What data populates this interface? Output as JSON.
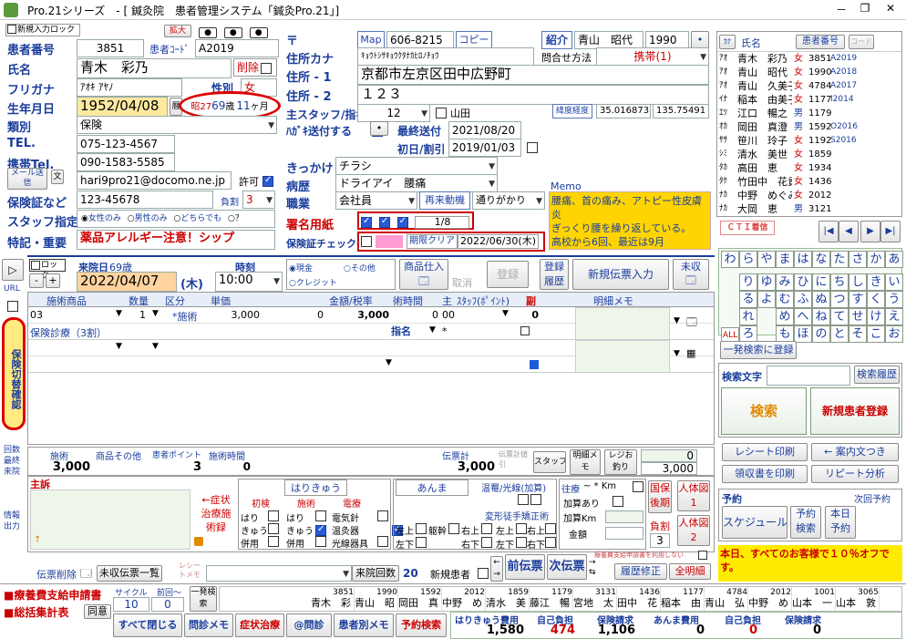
{
  "window": {
    "title": "Pro.21シリーズ　- [ 鍼灸院　患者管理システム「鍼灸Pro.21」]",
    "minimize": "－",
    "restore": "❐",
    "close": "✕"
  },
  "toolbar": {
    "new_patient": "新規入力ロック",
    "expand": "拡大"
  },
  "patient": {
    "id_label": "患者番号",
    "id": "3851",
    "code_label": "患者ｺｰﾄﾞ",
    "code": "A2019",
    "name_label": "氏名",
    "name": "青木　彩乃",
    "delete_label": "削除",
    "furigana_label": "フリガナ",
    "furigana": "ｱｵｷ ｱﾔﾉ",
    "sex_label": "性別",
    "sex": "女",
    "birth_label": "生年月日",
    "birth": "1952/04/08",
    "calendar_btn": "暦",
    "age_era": "昭27",
    "age_years": "69",
    "age_unit": "歳",
    "age_months": "11",
    "age_month_unit": "ヶ月",
    "type_label": "類別",
    "type": "保険",
    "tel_label": "TEL.",
    "tel": "075-123-4567",
    "mobile_label": "携帯Tel.",
    "mobile": "090-1583-5585",
    "mail_btn": "メール送信",
    "mail_icon": "文",
    "email": "hari9pro21@docomo.ne.jp",
    "permit": "許可",
    "insurance_label": "保険証など",
    "insurance": "123-45678",
    "burden_label": "負割",
    "burden": "3",
    "staff_label": "スタッフ指定",
    "staff_opt1": "女性のみ",
    "staff_opt2": "男性のみ",
    "staff_opt3": "どちらでも",
    "staff_q": "？",
    "notes_label": "特記・重要",
    "notes": "薬品アレルギー注意！シップ"
  },
  "address": {
    "postal_mark": "〒",
    "map_btn": "Map",
    "postal": "606-8215",
    "copy_btn": "コピー",
    "address_kana_label": "住所カナ",
    "address_kana": "ｷｮｳﾄｼｻｷｮｳｸﾀﾅｶﾋﾛﾉﾁｮｳ",
    "address1_label": "住所 - 1",
    "address1": "京都市左京区田中広野町",
    "address2_label": "住所 - 2",
    "address2": "１２３",
    "staff_assign_label": "主スタッフ/指名",
    "staff_assign": "12",
    "staff_name": "山田",
    "latlon_btn": "緯度経度",
    "lat": "35.016873",
    "lon": "135.75491",
    "postcard_label": "ﾊｶﾞｷ送付する",
    "last_sent_label": "最終送付",
    "last_sent": "2021/08/20",
    "first_visit_label": "初日/割引",
    "first_visit": "2019/01/03"
  },
  "referral": {
    "label": "紹介",
    "name": "青山　昭代",
    "code": "1990",
    "contact_label": "問合せ方法",
    "contact": "携帯(1)"
  },
  "details": {
    "trigger_label": "きっかけ",
    "trigger": "チラシ",
    "disease_label": "病歴",
    "disease": "ドライアイ　腰痛",
    "job_label": "職業",
    "job": "会社員",
    "revisit_label": "再来動機",
    "revisit": "通りがかり",
    "signature_label": "署名用紙",
    "signature_count": "1/8",
    "cert_label": "保険証チェック",
    "cert_limit_btn": "期限クリア",
    "cert_date": "2022/06/30(木)"
  },
  "memo": {
    "label": "Memo",
    "text": "腰痛、首の痛み、アトピー性皮膚炎\nぎっくり腰を繰り返している。\n高校から6回、最近は9月"
  },
  "patient_list": {
    "col_kana": "ｶﾅ",
    "col_name": "氏名",
    "col_id": "患者番号",
    "col_code": "コード",
    "rows": [
      {
        "kana": "ｱｵ",
        "name": "青木　彩乃",
        "sex": "女",
        "id": "3851",
        "code": "A2019",
        "f": true
      },
      {
        "kana": "ｱｵ",
        "name": "青山　昭代",
        "sex": "女",
        "id": "1990",
        "code": "A2018",
        "f": true
      },
      {
        "kana": "ｱｵ",
        "name": "青山　久美子",
        "sex": "女",
        "id": "4784",
        "code": "A2017",
        "f": true
      },
      {
        "kana": "ｲﾅ",
        "name": "稲本　由美子",
        "sex": "女",
        "id": "1177",
        "code": "I2014",
        "f": true
      },
      {
        "kana": "ｴﾂ",
        "name": "江口　暢之",
        "sex": "男",
        "id": "1179",
        "code": "",
        "f": false
      },
      {
        "kana": "ｵｶ",
        "name": "岡田　真澄",
        "sex": "男",
        "id": "1592",
        "code": "O2016",
        "f": false
      },
      {
        "kana": "ｻｻ",
        "name": "笹川　玲子",
        "sex": "女",
        "id": "1192",
        "code": "S2016",
        "f": true
      },
      {
        "kana": "ｼﾐ",
        "name": "清水　美世",
        "sex": "女",
        "id": "1859",
        "code": "",
        "f": true
      },
      {
        "kana": "ﾀｶ",
        "name": "高田　恵",
        "sex": "女",
        "id": "1934",
        "code": "",
        "f": true
      },
      {
        "kana": "ﾀｹ",
        "name": "竹田中　花貴子",
        "sex": "女",
        "id": "1436",
        "code": "",
        "f": true
      },
      {
        "kana": "ﾅｶ",
        "name": "中野　めぐみ",
        "sex": "女",
        "id": "2012",
        "code": "",
        "f": true
      },
      {
        "kana": "ﾅｶ",
        "name": "大岡　恵",
        "sex": "男",
        "id": "3121",
        "code": "",
        "f": false
      }
    ],
    "cti_btn": "ＣＴＩ着信"
  },
  "nav": {
    "first": "|◀",
    "prev": "◀",
    "next": "▶",
    "last": "▶|"
  },
  "kana_grid": [
    [
      "わ",
      "ら",
      "や",
      "ま",
      "は",
      "な",
      "た",
      "さ",
      "か",
      "あ"
    ],
    [
      "",
      "り",
      "ゆ",
      "み",
      "ひ",
      "に",
      "ち",
      "し",
      "き",
      "い"
    ],
    [
      "",
      "る",
      "よ",
      "む",
      "ふ",
      "ぬ",
      "つ",
      "す",
      "く",
      "う"
    ],
    [
      "",
      "れ",
      "",
      "め",
      "へ",
      "ね",
      "て",
      "せ",
      "け",
      "え"
    ],
    [
      "ALL",
      "ろ",
      "",
      "も",
      "ほ",
      "の",
      "と",
      "そ",
      "こ",
      "お"
    ]
  ],
  "search": {
    "quick_btn": "一発検索に登録",
    "label": "検索文字",
    "history_btn": "検索履歴",
    "search_btn": "検索",
    "new_patient_btn": "新規患者登録"
  },
  "side_actions": {
    "receipt": "レシート印刷",
    "guide": "← 案内文つき",
    "ryoshu": "領収書を印刷",
    "repeat": "リピート分析"
  },
  "reservation": {
    "label": "予約",
    "next_label": "次回予約",
    "schedule": "スケジュール",
    "search": "予約検索",
    "today": "本日予約"
  },
  "promo": "本日、すべてのお客様で１０％オフです。",
  "left_bar": {
    "url": "URL",
    "insurance_switch": "保険切替確認",
    "visits": "回数",
    "last_visit": "最終来院",
    "info_out": "情報出力"
  },
  "visit": {
    "lock": "ロック",
    "last_visit_label": "来院日",
    "age": "69歳",
    "date": "2022/04/07",
    "weekday": "(木)",
    "time_label": "時刻",
    "time": "10:00",
    "cash": "現金",
    "other": "その他",
    "credit": "クレジット",
    "goods_btn": "商品仕入",
    "cancel": "取消",
    "register": "登録",
    "history": "登録履歴",
    "new_slip": "新規伝票入力",
    "unpaid": "未収"
  },
  "treat_table": {
    "headers": [
      "施術商品",
      "数量",
      "区分",
      "単価",
      "金額/税率",
      "術時間",
      "主",
      "ｽﾀｯﾌ(ﾎﾟｲﾝﾄ)",
      "副",
      "明細メモ"
    ],
    "row1": {
      "code": "03",
      "qty": "1",
      "cat": "*施術",
      "price": "3,000",
      "tax": "0",
      "amount": "3,000",
      "time": "0",
      "main": "00",
      "pt": "0"
    },
    "row2_label": "保険診療（3割）",
    "nominate": "指名",
    "star": "*"
  },
  "totals": {
    "treat_label": "施術",
    "treat": "3,000",
    "goods_label": "商品その他",
    "goods": "",
    "pt_label": "患者ポイント",
    "pt": "3",
    "time_label": "施術時間",
    "time": "0",
    "slip_label": "伝票計",
    "slip": "3,000",
    "slip_discount": "伝票計値引",
    "staff": "スタッフ",
    "detail_memo": "明細メモ",
    "register": "レジお釣り",
    "change_top": "0",
    "change": "3,000"
  },
  "complaint": {
    "label": "主訴",
    "symptom_btn": "←症状治療施術録",
    "hari_label": "はりきゅう",
    "first_label": "初検",
    "treat_label": "施術",
    "elec_label": "電療",
    "hari": "はり",
    "kyu": "きゅう",
    "combo": "併用",
    "elec_needle": "電気針",
    "warm": "温灸器",
    "light": "光線器具",
    "anma": "あんま",
    "warm_light": "温罨/光線(加算)",
    "transform": "変形徒手矯正術",
    "zone_up_left": "左上",
    "zone_body": "躯幹",
    "zone_up_right": "右上",
    "zone_down_left": "左下",
    "zone_down_right": "右下",
    "zone_left_up2": "左上",
    "zone_right_up2": "右上",
    "zone_left_down2": "左下",
    "zone_right_down2": "右下",
    "ship": "往療",
    "km": "~ * Km",
    "add": "加算あり",
    "add_km": "加算Km",
    "amount": "金額",
    "ins_later": "国保後期",
    "burden": "負割",
    "burden_val": "3",
    "body1": "人体図1",
    "body2": "人体図2"
  },
  "footer": {
    "delete": "伝票削除",
    "unpaid_list": "未収伝票一覧",
    "receipt_memo": "レシートメモ",
    "visit_count_label": "来院回数",
    "visit_count": "20",
    "new_patient": "新規患者",
    "prev_slip": "前伝票",
    "next_slip": "次伝票",
    "ryoyo_note": "療養費支給申請書を利用しない",
    "history_fix": "履歴修正",
    "all_detail": "全明細"
  },
  "bottom": {
    "apply": "療養費支給申請書",
    "total": "総括集計表",
    "cycle_label": "サイクル",
    "prev_label": "前回～",
    "cycle": "10",
    "prev": "0",
    "consent": "同意",
    "quick_search": "一発検索",
    "history_ids": [
      "3851",
      "1990",
      "1592",
      "2012",
      "1859",
      "1179",
      "3131",
      "1436",
      "1177",
      "4784",
      "2012",
      "1001",
      "3065"
    ],
    "history_names": [
      "青木　彩",
      "青山　昭",
      "岡田　真",
      "中野　め",
      "清水　美",
      "藤江　暢",
      "宮地　太",
      "田中　花",
      "稲本　由",
      "青山　弘",
      "中野　め",
      "山本　一",
      "山本　敦"
    ],
    "close_all": "すべて閉じる",
    "q_memo": "問診メモ",
    "symptom": "症状治療",
    "q_check": "@問診",
    "patient_memo": "患者別メモ",
    "res_search": "予約検索",
    "hari_cost_label": "はりきゅう費用",
    "hari_cost": "1,580",
    "self1_label": "自己負担",
    "self1": "474",
    "ins1_label": "保険請求",
    "ins1": "1,106",
    "anma_label": "あんま費用",
    "anma": "0",
    "self2_label": "自己負担",
    "self2": "0",
    "ins2_label": "保険請求",
    "ins2": "0"
  },
  "colors": {
    "accent": "#1a3d9c",
    "red": "#cc0000",
    "promo_bg": "#ffeb00",
    "memo_bg": "#ffd400"
  }
}
